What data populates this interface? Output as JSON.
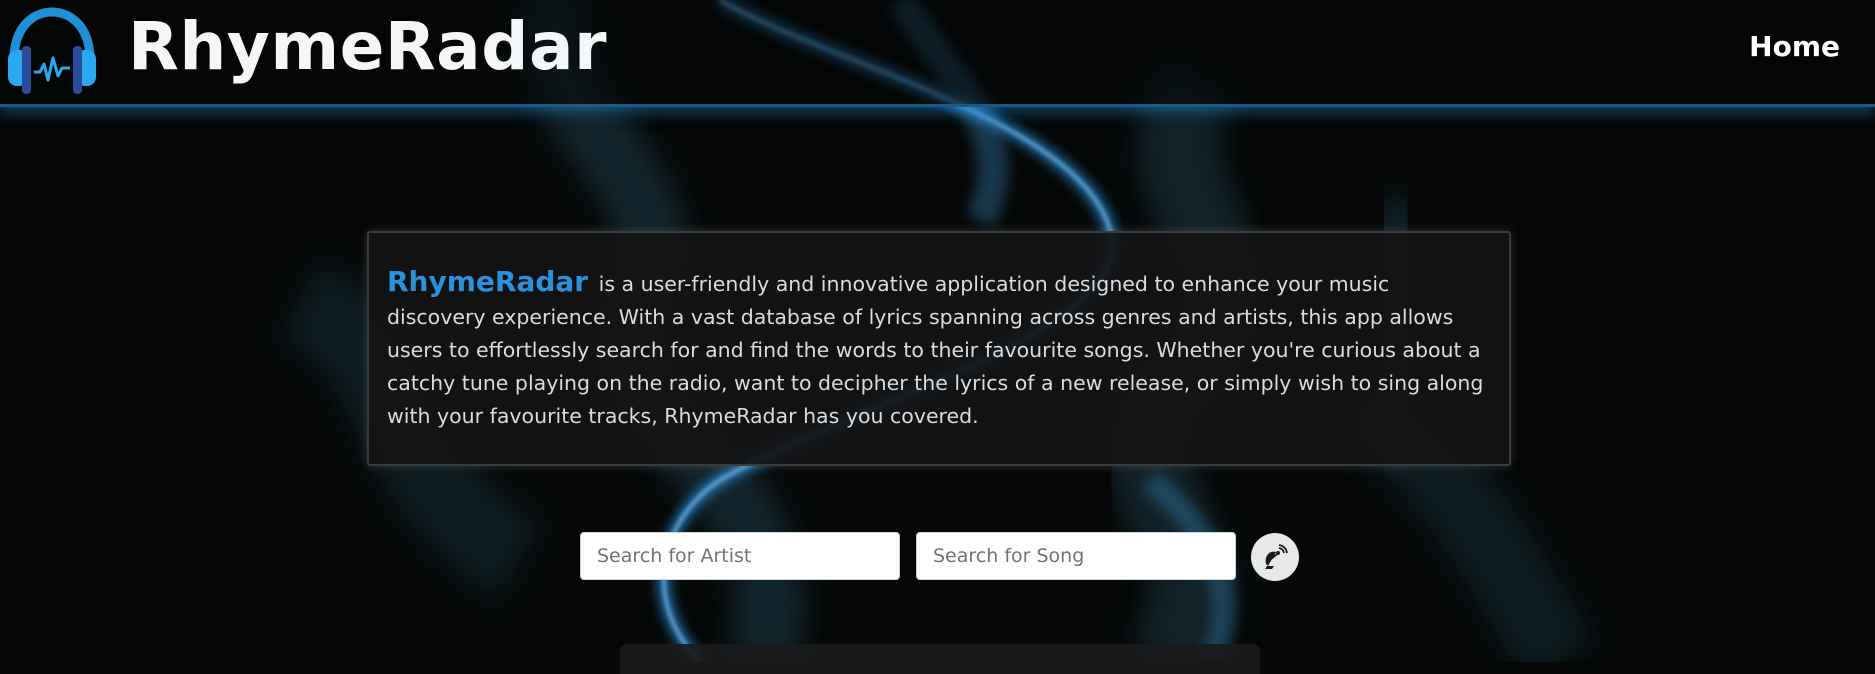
{
  "colors": {
    "accent": "#2a92dc",
    "background": "#060808",
    "panel": "#141415",
    "glow": "#1e8cdc"
  },
  "header": {
    "brand": "RhymeRadar",
    "logo_icon": "headphones-icon",
    "nav": {
      "home_label": "Home"
    }
  },
  "about": {
    "brand": "RhymeRadar",
    "text": " is a user-friendly and innovative application designed to enhance your music discovery experience. With a vast database of lyrics spanning across genres and artists, this app allows users to effortlessly search for and find the words to their favourite songs. Whether you're curious about a catchy tune playing on the radio, want to decipher the lyrics of a new release, or simply wish to sing along with your favourite tracks, RhymeRadar has you covered."
  },
  "search": {
    "artist_placeholder": "Search for Artist",
    "artist_value": "",
    "song_placeholder": "Search for Song",
    "song_value": "",
    "button_icon": "satellite-dish-icon"
  }
}
